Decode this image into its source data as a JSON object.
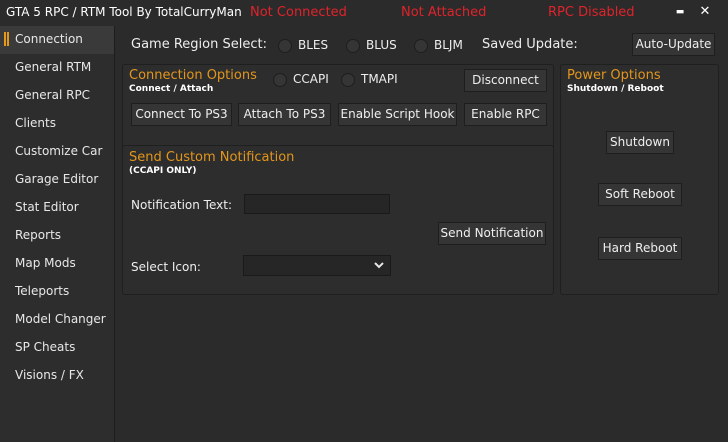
{
  "window": {
    "title": "GTA 5 RPC / RTM Tool By TotalCurryMan",
    "status_connection": "Not Connected",
    "status_attach": "Not Attached",
    "status_rpc": "RPC Disabled",
    "minimize_glyph": "▬",
    "close_glyph": "✕"
  },
  "sidebar": {
    "items": [
      {
        "label": "Connection",
        "active": true
      },
      {
        "label": "General RTM"
      },
      {
        "label": "General RPC"
      },
      {
        "label": "Clients"
      },
      {
        "label": "Customize Car"
      },
      {
        "label": "Garage Editor"
      },
      {
        "label": "Stat Editor"
      },
      {
        "label": "Reports"
      },
      {
        "label": "Map Mods"
      },
      {
        "label": "Teleports"
      },
      {
        "label": "Model Changer"
      },
      {
        "label": "SP Cheats"
      },
      {
        "label": "Visions / FX"
      }
    ]
  },
  "region": {
    "label": "Game Region Select:",
    "options": [
      "BLES",
      "BLUS",
      "BLJM"
    ],
    "saved_label": "Saved Update:",
    "auto_update_label": "Auto-Update"
  },
  "connection": {
    "title": "Connection Options",
    "subtitle": "Connect / Attach",
    "api_options": [
      "CCAPI",
      "TMAPI"
    ],
    "disconnect_label": "Disconnect",
    "connect_label": "Connect To PS3",
    "attach_label": "Attach To PS3",
    "script_hook_label": "Enable Script Hook",
    "rpc_label": "Enable RPC"
  },
  "notification": {
    "title": "Send Custom Notification",
    "subtitle": "(CCAPI ONLY)",
    "text_label": "Notification Text:",
    "text_value": "",
    "send_label": "Send Notification",
    "icon_label": "Select Icon:",
    "icon_value": ""
  },
  "power": {
    "title": "Power Options",
    "subtitle": "Shutdown / Reboot",
    "shutdown_label": "Shutdown",
    "soft_reboot_label": "Soft Reboot",
    "hard_reboot_label": "Hard Reboot"
  },
  "colors": {
    "accent": "#e3961c",
    "status_red": "#e0232b",
    "background": "#2b2b2b"
  }
}
